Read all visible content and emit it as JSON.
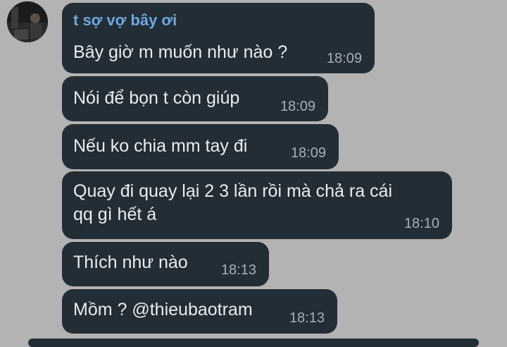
{
  "chat": {
    "sender_name": "t sợ vợ bây ơi",
    "messages": [
      {
        "text": "Bây giờ m muốn như nào ?",
        "time": "18:09"
      },
      {
        "text": "Nói để bọn t còn giúp",
        "time": "18:09"
      },
      {
        "text": "Nếu ko chia mm tay đi",
        "time": "18:09"
      },
      {
        "text": "Quay đi quay lại 2 3 lần rồi mà chả ra cái\nqq gì hết á",
        "time": "18:10"
      },
      {
        "text": "Thích như nào",
        "time": "18:13"
      },
      {
        "text": "Mồm ? @thieubaotram",
        "time": "18:13"
      }
    ]
  },
  "colors": {
    "background": "#b3b3b3",
    "bubble": "#232d36",
    "sender": "#6ea8e0",
    "text": "#e9edef",
    "time": "#a8b0b6"
  }
}
